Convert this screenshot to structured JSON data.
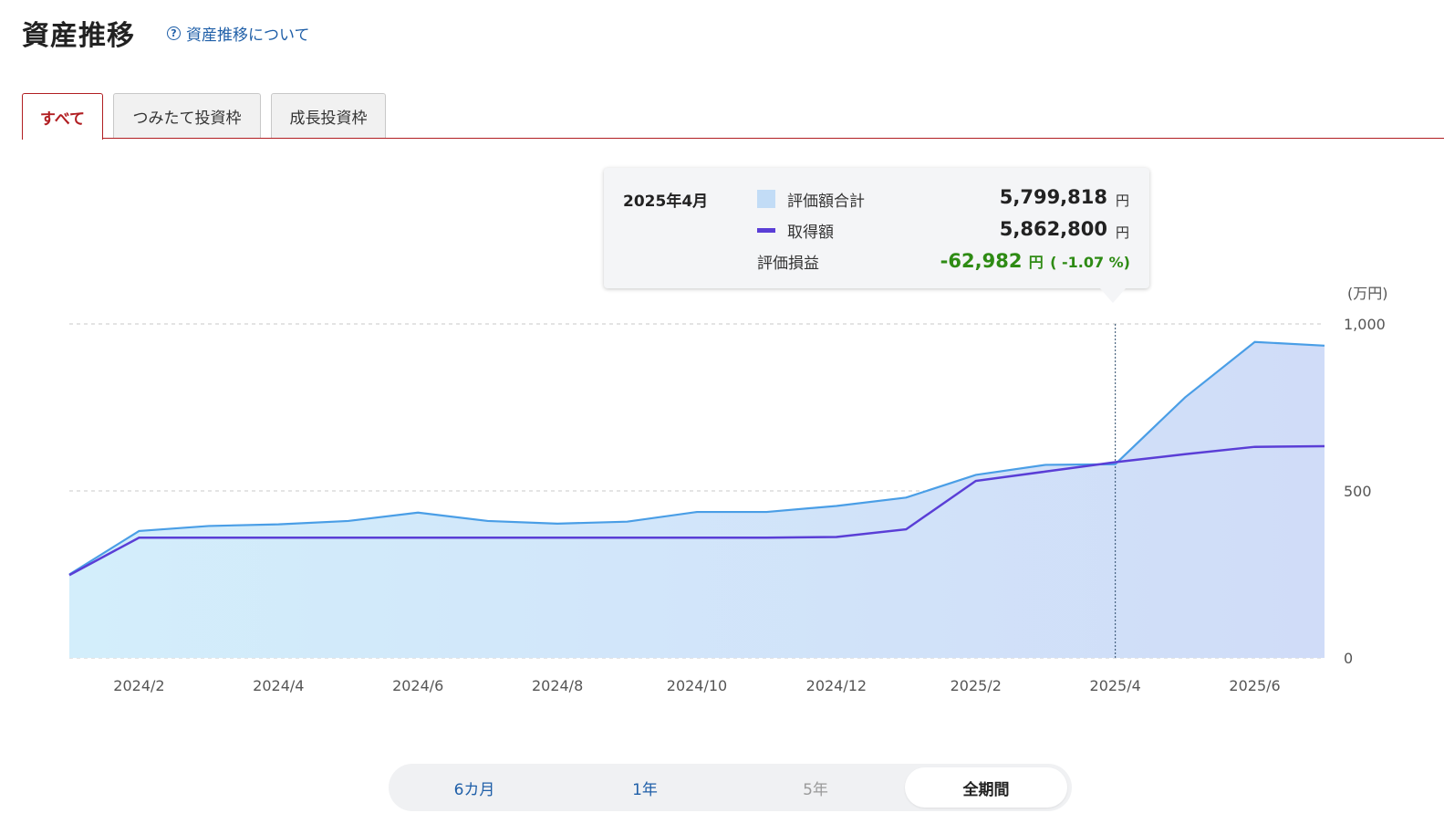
{
  "header": {
    "title": "資産推移",
    "help_link": "資産推移について",
    "help_icon": "question-circle-icon"
  },
  "tabs": [
    {
      "label": "すべて",
      "active": true
    },
    {
      "label": "つみたて投資枠",
      "active": false
    },
    {
      "label": "成長投資枠",
      "active": false
    }
  ],
  "tooltip": {
    "month": "2025年4月",
    "eval_label": "評価額合計",
    "eval_value": "5,799,818",
    "acq_label": "取得額",
    "acq_value": "5,862,800",
    "pl_label": "評価損益",
    "pl_value": "-62,982",
    "pl_pct": "( -1.07 %)",
    "unit": "円"
  },
  "period_buttons": [
    {
      "label": "6カ月",
      "state": "enabled"
    },
    {
      "label": "1年",
      "state": "enabled"
    },
    {
      "label": "5年",
      "state": "disabled"
    },
    {
      "label": "全期間",
      "state": "active"
    }
  ],
  "colors": {
    "accent": "#b11e22",
    "link": "#1f5fa8",
    "eval_line": "#4a86e0",
    "eval_fill": "#c2dcf6",
    "acq_line": "#5a3ed6",
    "profit_loss": "#2e8b14"
  },
  "chart_data": {
    "type": "area",
    "unit_label": "(万円)",
    "y_ticks": [
      "0",
      "500",
      "1,000"
    ],
    "ylim": [
      0,
      1000
    ],
    "x_tick_labels": [
      "2024/2",
      "2024/4",
      "2024/6",
      "2024/8",
      "2024/10",
      "2024/12",
      "2025/2",
      "2025/4",
      "2025/6"
    ],
    "x": [
      "2024/1",
      "2024/2",
      "2024/3",
      "2024/4",
      "2024/5",
      "2024/6",
      "2024/7",
      "2024/8",
      "2024/9",
      "2024/10",
      "2024/11",
      "2024/12",
      "2025/1",
      "2025/2",
      "2025/3",
      "2025/4",
      "2025/5",
      "2025/6",
      "2025/7"
    ],
    "series": [
      {
        "name": "評価額合計",
        "style": "area",
        "values": [
          250,
          380,
          395,
          400,
          410,
          435,
          410,
          402,
          408,
          437,
          437,
          455,
          480,
          548,
          578,
          580,
          780,
          946,
          935
        ]
      },
      {
        "name": "取得額",
        "style": "line",
        "values": [
          248,
          360,
          360,
          360,
          360,
          360,
          360,
          360,
          360,
          360,
          360,
          362,
          385,
          530,
          558,
          586,
          610,
          632,
          634
        ]
      }
    ],
    "highlight_x": "2025/4",
    "grid": true,
    "legend": "tooltip"
  }
}
